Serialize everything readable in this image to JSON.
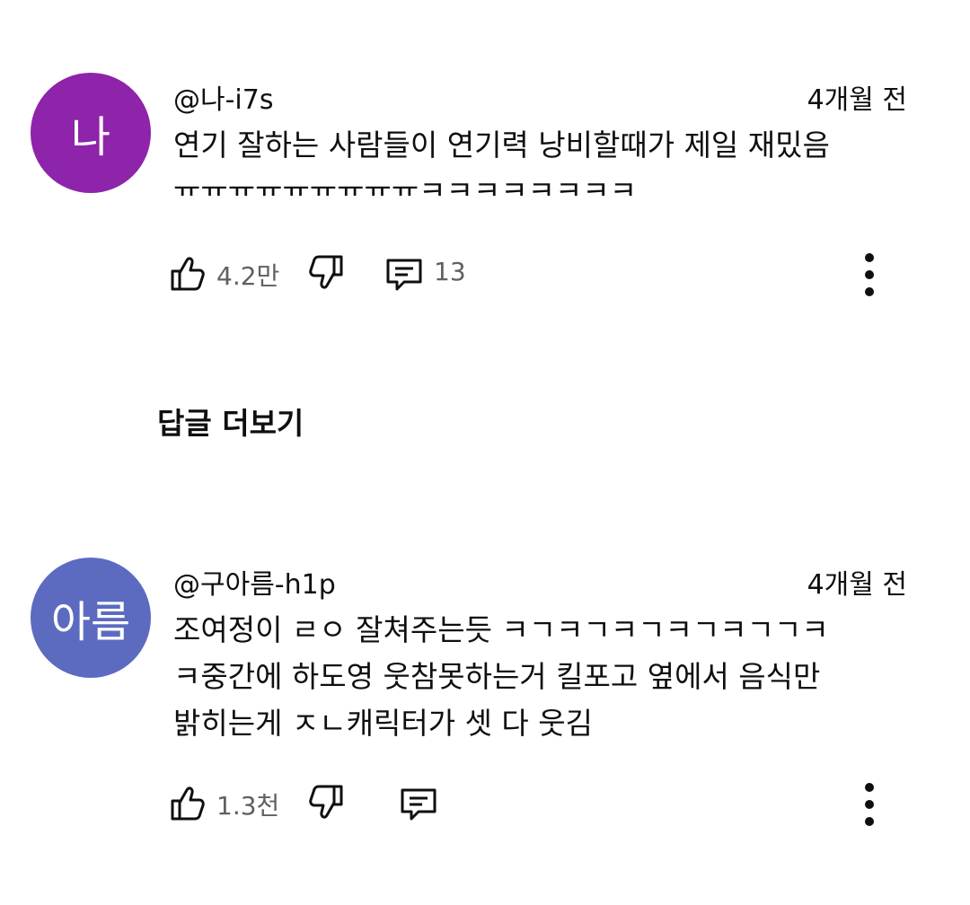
{
  "comments": [
    {
      "avatar_text": "나",
      "avatar_color": "#8e24aa",
      "author": "@나-i7s",
      "time": "4개월 전",
      "text_line1": "연기 잘하는 사람들이 연기력 낭비할때가 제일 재밌음",
      "text_line2": "ㅠㅠㅠㅠㅠㅠㅠㅠㅠㅋㅋㅋㅋㅋㅋㅋㅋ",
      "likes": "4.2만",
      "replies": "13",
      "icons": [
        "thumbs-up-icon",
        "thumbs-down-icon",
        "reply-icon",
        "more-vert-icon"
      ]
    },
    {
      "avatar_text": "아름",
      "avatar_color": "#5c6bc0",
      "author": "@구아름-h1p",
      "time": "4개월 전",
      "text_line1": "조여정이 ㄹㅇ 잘쳐주는듯 ㅋㄱㅋㄱㅋㄱㅋㄱㅋㄱㄱㅋ",
      "text_line2": "ㅋ중간에 하도영 웃참못하는거 킬포고 옆에서 음식만",
      "text_line3": "밝히는게 ㅈㄴ캐릭터가 셋 다 웃김",
      "likes": "1.3천",
      "icons": [
        "thumbs-up-icon",
        "thumbs-down-icon",
        "reply-icon",
        "more-vert-icon"
      ]
    }
  ],
  "more_replies_label": "답글 더보기"
}
